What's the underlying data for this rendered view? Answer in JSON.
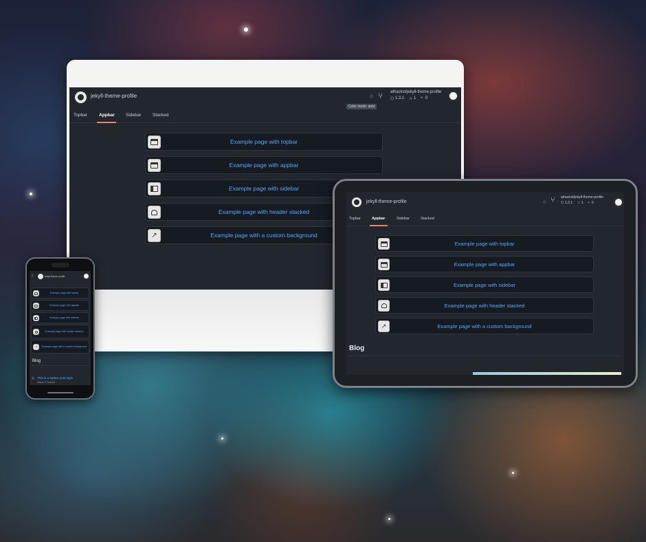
{
  "app": {
    "title": "jekyll-theme-profile",
    "repo": "athackst/jekyll-theme-profile",
    "version": "1.3.1",
    "stars": "1",
    "forks": "0",
    "tooltip": "Color mode: auto"
  },
  "tabs": [
    "Topbar",
    "Appbar",
    "Sidebar",
    "Stacked"
  ],
  "examples": [
    "Example page with topbar",
    "Example page with appbar",
    "Example page with sidebar",
    "Example page with header stacked",
    "Example page with a custom background"
  ],
  "blog": {
    "heading": "Blog",
    "post_title": "This is a topbar post style",
    "post_author": "Allison P Burdett"
  },
  "icons": [
    "github-icon",
    "git-branch-icon",
    "tag-icon",
    "star-icon",
    "fork-icon",
    "avatar-icon",
    "topbar-layout-icon",
    "appbar-layout-icon",
    "sidebar-layout-icon",
    "header-stacked-icon",
    "custom-background-icon"
  ]
}
